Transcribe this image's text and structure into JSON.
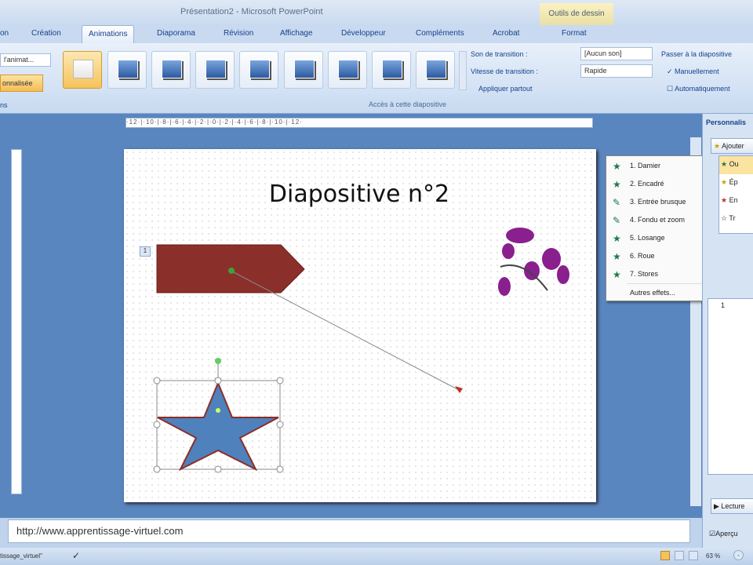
{
  "window": {
    "title": "Présentation2 - Microsoft PowerPoint",
    "context_tab": "Outils de dessin"
  },
  "tabs": [
    "on",
    "Création",
    "Animations",
    "Diaporama",
    "Révision",
    "Affichage",
    "Développeur",
    "Compléments",
    "Acrobat",
    "Format"
  ],
  "ribbon": {
    "animate_dropdown": "l'animat...",
    "custom_button": "onnalisée",
    "left_group_label": "ns",
    "sound_label": "Son de transition :",
    "sound_value": "[Aucun son]",
    "speed_label": "Vitesse de transition :",
    "speed_value": "Rapide",
    "apply_all": "Appliquer partout",
    "group_label": "Accès à cette diapositive",
    "advance_label": "Passer à la diapositive",
    "manual": "Manuellement",
    "auto": "Automatiquement"
  },
  "ruler": "·12·|·10·|·8·|·6·|·4·|·2·|·0·|·2·|·4·|·6·|·8·|·10·|·12·",
  "slide": {
    "title": "Diapositive n°2",
    "anim_badge": "1"
  },
  "menu": {
    "items": [
      "1. Damier",
      "2. Encadré",
      "3. Entrée brusque",
      "4. Fondu et zoom",
      "5. Losange",
      "6. Roue",
      "7. Stores"
    ],
    "more": "Autres effets..."
  },
  "pane": {
    "header": "Personnalis",
    "add_button": "Ajouter",
    "items": [
      "Ou",
      "Ép",
      "En",
      "Tr"
    ],
    "row": "1",
    "play": "Lecture",
    "preview": "Aperçu"
  },
  "notes": "http://www.apprentissage-virtuel.com",
  "status": {
    "theme": "tissage_virtuel\"",
    "zoom": "63 %"
  }
}
